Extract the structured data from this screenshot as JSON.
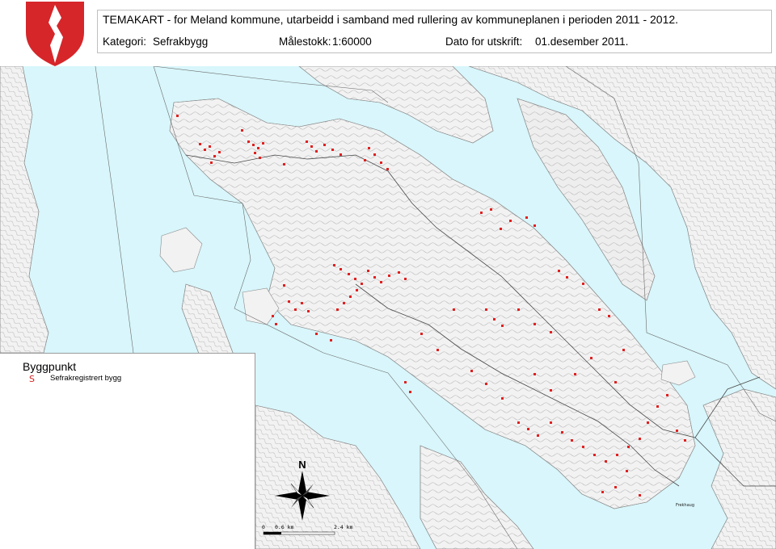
{
  "header": {
    "title": "TEMAKART - for Meland kommune, utarbeidd i samband med rullering av kommuneplanen i perioden 2011 - 2012.",
    "category_label": "Kategori:",
    "category_value": "Sefrakbygg",
    "scale_label": "Målestokk:",
    "scale_value": "1:60000",
    "date_label": "Dato for utskrift:",
    "date_value": "01.desember 2011."
  },
  "legend": {
    "heading": "Byggpunkt",
    "symbol": "S",
    "item_label": "Sefrakregistrert bygg"
  },
  "compass": {
    "north_label": "N"
  },
  "scalebar": {
    "labels": [
      "0",
      "0.6 km",
      "2.4 km"
    ]
  },
  "map": {
    "place_names": [
      "Frekhaug"
    ],
    "colors": {
      "sea": "#d8f6fb",
      "land": "#f2f2f2",
      "sefrak_marker": "#e02020",
      "crest_red": "#d6262a"
    }
  }
}
